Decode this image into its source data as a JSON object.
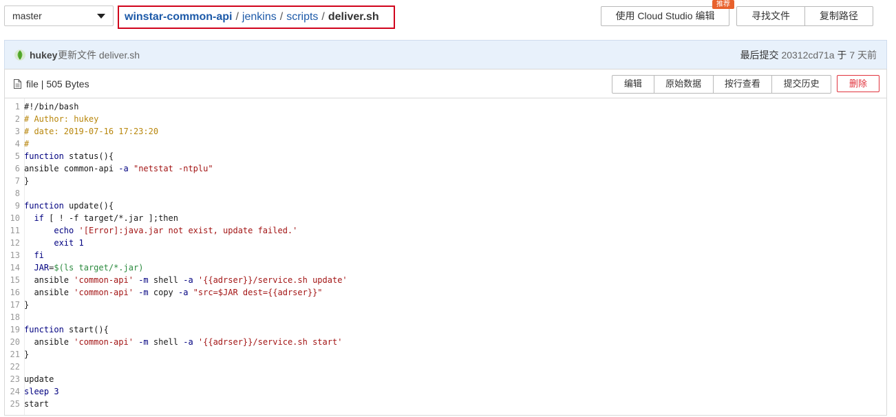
{
  "branch": {
    "label": "master"
  },
  "breadcrumb": {
    "repo": "winstar-common-api",
    "parts": [
      "jenkins",
      "scripts"
    ],
    "file": "deliver.sh",
    "separator": "/"
  },
  "toolbar": {
    "cloud_label": "使用 Cloud Studio 编辑",
    "cloud_badge": "推荐",
    "find_file": "寻找文件",
    "copy_path": "复制路径"
  },
  "commit": {
    "author": "hukey",
    "message": "更新文件 deliver.sh",
    "last_label": "最后提交",
    "hash": "20312cd71a",
    "at_label": "于",
    "ago": "7 天前"
  },
  "file": {
    "info": "file | 505 Bytes",
    "actions": [
      "编辑",
      "原始数据",
      "按行查看",
      "提交历史"
    ],
    "delete": "删除"
  },
  "colors": {
    "accent": "#1c59a8",
    "danger": "#e0323c",
    "highlight_box": "#d0021b",
    "badge": "#e8612c"
  },
  "code": [
    [
      {
        "c": "tx",
        "t": "#!/bin/bash"
      }
    ],
    [
      {
        "c": "cm",
        "t": "# Author: hukey"
      }
    ],
    [
      {
        "c": "cm",
        "t": "# date: 2019-07-16 17:23:20"
      }
    ],
    [
      {
        "c": "cm",
        "t": "#"
      }
    ],
    [
      {
        "c": "kw",
        "t": "function"
      },
      {
        "c": "fn",
        "t": " status(){"
      }
    ],
    [
      {
        "c": "tx",
        "t": "ansible common-api "
      },
      {
        "c": "op",
        "t": "-a"
      },
      {
        "c": "tx",
        "t": " "
      },
      {
        "c": "st",
        "t": "\"netstat -ntplu\""
      }
    ],
    [
      {
        "c": "tx",
        "t": "}"
      }
    ],
    [
      {
        "c": "tx",
        "t": ""
      }
    ],
    [
      {
        "c": "kw",
        "t": "function"
      },
      {
        "c": "fn",
        "t": " update(){"
      }
    ],
    [
      {
        "c": "tx",
        "t": "  "
      },
      {
        "c": "kw",
        "t": "if"
      },
      {
        "c": "tx",
        "t": " [ ! -f target/*.jar ];then"
      }
    ],
    [
      {
        "c": "tx",
        "t": "      "
      },
      {
        "c": "kw",
        "t": "echo"
      },
      {
        "c": "tx",
        "t": " "
      },
      {
        "c": "st",
        "t": "'[Error]:java.jar not exist, update failed.'"
      }
    ],
    [
      {
        "c": "tx",
        "t": "      "
      },
      {
        "c": "kw",
        "t": "exit"
      },
      {
        "c": "tx",
        "t": " "
      },
      {
        "c": "num",
        "t": "1"
      }
    ],
    [
      {
        "c": "tx",
        "t": "  "
      },
      {
        "c": "kw",
        "t": "fi"
      }
    ],
    [
      {
        "c": "tx",
        "t": "  "
      },
      {
        "c": "kw",
        "t": "JAR"
      },
      {
        "c": "tx",
        "t": "="
      },
      {
        "c": "var",
        "t": "$(ls target/*.jar)"
      }
    ],
    [
      {
        "c": "tx",
        "t": "  ansible "
      },
      {
        "c": "st",
        "t": "'common-api'"
      },
      {
        "c": "tx",
        "t": " "
      },
      {
        "c": "op",
        "t": "-m"
      },
      {
        "c": "tx",
        "t": " shell "
      },
      {
        "c": "op",
        "t": "-a"
      },
      {
        "c": "tx",
        "t": " "
      },
      {
        "c": "st",
        "t": "'{{adrser}}/service.sh update'"
      }
    ],
    [
      {
        "c": "tx",
        "t": "  ansible "
      },
      {
        "c": "st",
        "t": "'common-api'"
      },
      {
        "c": "tx",
        "t": " "
      },
      {
        "c": "op",
        "t": "-m"
      },
      {
        "c": "tx",
        "t": " copy "
      },
      {
        "c": "op",
        "t": "-a"
      },
      {
        "c": "tx",
        "t": " "
      },
      {
        "c": "st",
        "t": "\"src=$JAR dest={{adrser}}\""
      }
    ],
    [
      {
        "c": "tx",
        "t": "}"
      }
    ],
    [
      {
        "c": "tx",
        "t": ""
      }
    ],
    [
      {
        "c": "kw",
        "t": "function"
      },
      {
        "c": "fn",
        "t": " start(){"
      }
    ],
    [
      {
        "c": "tx",
        "t": "  ansible "
      },
      {
        "c": "st",
        "t": "'common-api'"
      },
      {
        "c": "tx",
        "t": " "
      },
      {
        "c": "op",
        "t": "-m"
      },
      {
        "c": "tx",
        "t": " shell "
      },
      {
        "c": "op",
        "t": "-a"
      },
      {
        "c": "tx",
        "t": " "
      },
      {
        "c": "st",
        "t": "'{{adrser}}/service.sh start'"
      }
    ],
    [
      {
        "c": "tx",
        "t": "}"
      }
    ],
    [
      {
        "c": "tx",
        "t": ""
      }
    ],
    [
      {
        "c": "tx",
        "t": "update"
      }
    ],
    [
      {
        "c": "kw",
        "t": "sleep"
      },
      {
        "c": "tx",
        "t": " "
      },
      {
        "c": "num",
        "t": "3"
      }
    ],
    [
      {
        "c": "tx",
        "t": "start"
      }
    ]
  ]
}
